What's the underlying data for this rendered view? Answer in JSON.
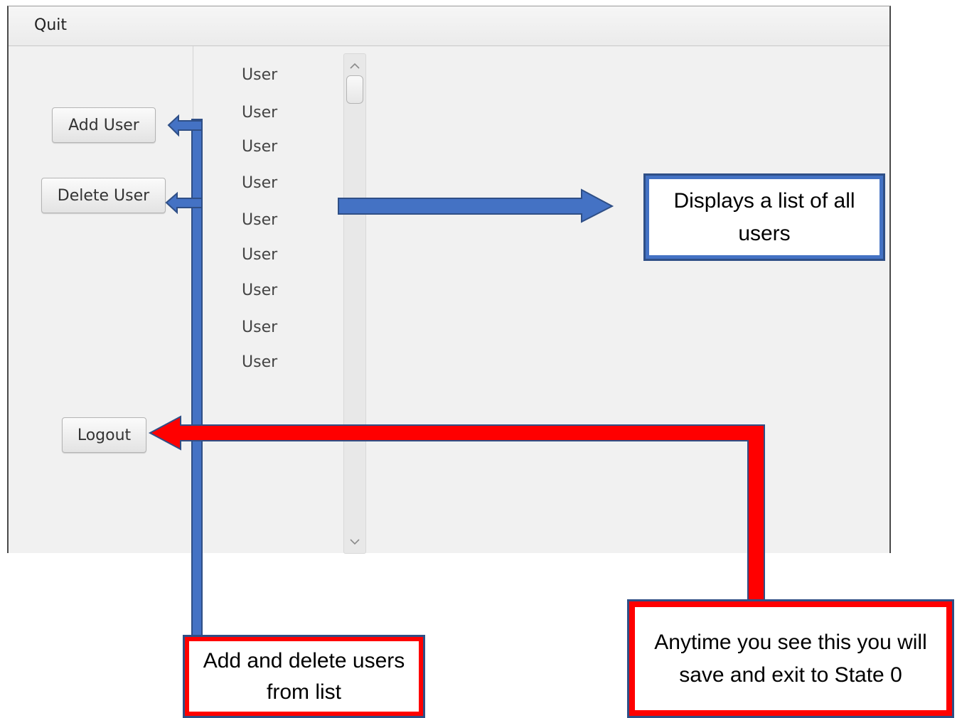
{
  "menu": {
    "quit_label": "Quit"
  },
  "buttons": {
    "add_user": "Add User",
    "delete_user": "Delete User",
    "logout": "Logout"
  },
  "user_list": [
    "User",
    "User",
    "User",
    "User",
    "User",
    "User",
    "User",
    "User",
    "User"
  ],
  "annotations": {
    "list_callout": "Displays a list of all users",
    "add_delete_callout": "Add and delete users from list",
    "logout_callout": "Anytime you see this you will save and exit to State 0"
  },
  "colors": {
    "blue_arrow": "#4472c4",
    "blue_border": "#2f4f86",
    "red_arrow": "#ff0000"
  },
  "icons": {
    "scroll_up": "chevron-up-icon",
    "scroll_down": "chevron-down-icon"
  }
}
